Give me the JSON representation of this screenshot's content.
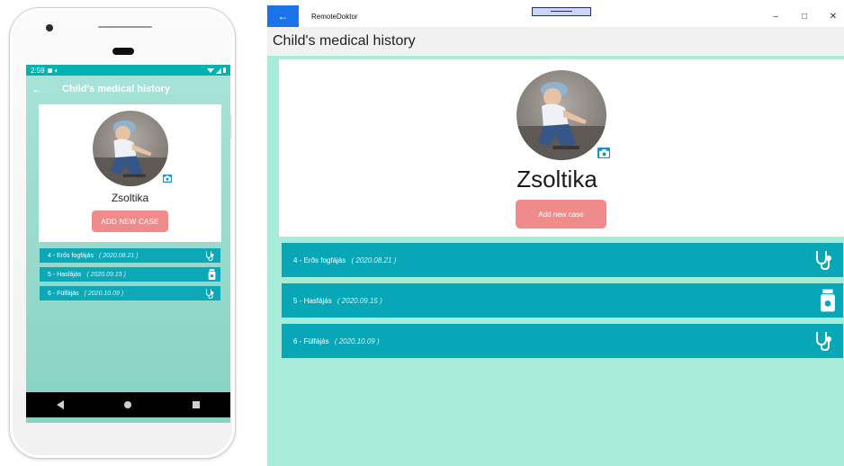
{
  "mobile": {
    "status_time": "2:59",
    "title": "Child's medical history",
    "child_name": "Zsoltika",
    "add_button": "ADD NEW CASE",
    "cases": [
      {
        "id": "4",
        "name": "Erős fogfájás",
        "date": "( 2020.08.21 )",
        "icon": "stethoscope-icon"
      },
      {
        "id": "5",
        "name": "Hasfájás",
        "date": "( 2020.09.15 )",
        "icon": "medicine-bottle-icon"
      },
      {
        "id": "6",
        "name": "Fülfájás",
        "date": "( 2020.10.09 )",
        "icon": "stethoscope-icon"
      }
    ]
  },
  "desktop": {
    "window_title": "RemoteDoktor",
    "page_title": "Child's medical history",
    "child_name": "Zsoltika",
    "add_button": "Add new case",
    "cases": [
      {
        "id": "4",
        "name": "Erős fogfájás",
        "date": "( 2020.08.21 )",
        "icon": "stethoscope-icon"
      },
      {
        "id": "5",
        "name": "Hasfájás",
        "date": "( 2020.09.15 )",
        "icon": "medicine-bottle-icon"
      },
      {
        "id": "6",
        "name": "Fülfájás",
        "date": "( 2020.10.09 )",
        "icon": "stethoscope-icon"
      }
    ]
  },
  "colors": {
    "accent_teal": "#07a7b7",
    "button_salmon": "#f08b8b",
    "background_mint": "#a6ecd9",
    "titlebar_back_blue": "#1a73e8"
  }
}
